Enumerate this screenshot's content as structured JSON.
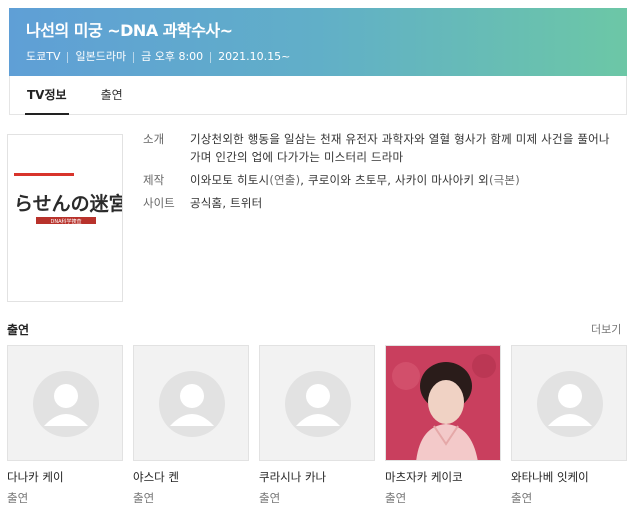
{
  "header": {
    "title": "나선의 미궁 ~DNA 과학수사~",
    "meta": [
      "도쿄TV",
      "일본드라마",
      "금 오후 8:00",
      "2021.10.15~"
    ]
  },
  "tabs": [
    {
      "label": "TV정보",
      "active": true
    },
    {
      "label": "출연",
      "active": false
    }
  ],
  "poster": {
    "logo_text": "らせんの迷宮",
    "sub_text": "DNA科学捜査"
  },
  "info": {
    "synopsis_label": "소개",
    "synopsis": "기상천외한 행동을 일삼는 천재 유전자 과학자와 열혈 형사가 함께 미제 사건을 풀어나가며 인간의 업에 다가가는 미스터리 드라마",
    "production_label": "제작",
    "director": "이와모토 히토시",
    "director_role": "(연출)",
    "writers": "쿠로이와 츠토무, 사카이 마사아키 외",
    "writers_role": "(극본)",
    "site_label": "사이트",
    "site_links": "공식홈, 트위터"
  },
  "cast": {
    "title": "출연",
    "more_label": "더보기",
    "members": [
      {
        "name": "다나카 케이",
        "role": "출연",
        "has_photo": false
      },
      {
        "name": "야스다 켄",
        "role": "출연",
        "has_photo": false
      },
      {
        "name": "쿠라시나 카나",
        "role": "출연",
        "has_photo": false
      },
      {
        "name": "마츠자카 케이코",
        "role": "출연",
        "has_photo": true
      },
      {
        "name": "와타나베 잇케이",
        "role": "출연",
        "has_photo": false
      }
    ]
  },
  "colors": {
    "header_gradient_start": "#5f9fd6",
    "header_gradient_end": "#6cc7a6",
    "photo_background": "#c93f5e"
  }
}
